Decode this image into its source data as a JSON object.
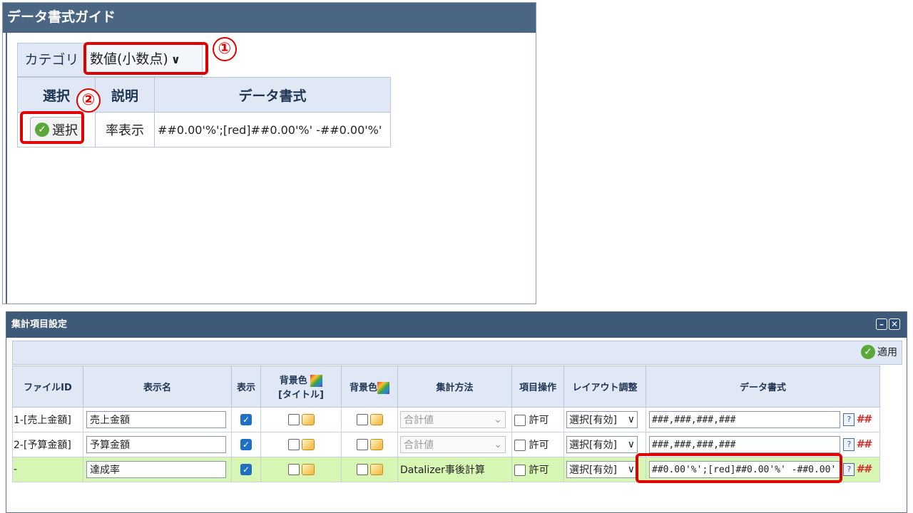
{
  "guide": {
    "title": "データ書式ガイド",
    "category_label": "カテゴリ",
    "category_value": "数値(小数点)",
    "headers": [
      "選択",
      "説明",
      "データ書式"
    ],
    "row": {
      "button": "選択",
      "desc": "率表示",
      "format": "##0.00'%';[red]##0.00'%' -##0.00'%'"
    },
    "badge1": "①",
    "badge2": "②"
  },
  "agg": {
    "title": "集計項目設定",
    "apply_label": "適用",
    "headers": {
      "file_id": "ファイルID",
      "name": "表示名",
      "show": "表示",
      "bg_title_1": "背景色",
      "bg_title_2": "[タイトル]",
      "bg": "背景色",
      "method": "集計方法",
      "item_op": "項目操作",
      "layout": "レイアウト調整",
      "format": "データ書式"
    },
    "rows": [
      {
        "file_id": "1-[売上金額]",
        "name": "売上金額",
        "method": "合計値",
        "permit": "許可",
        "layout": "選択[有効]",
        "format": "###,###,###,###"
      },
      {
        "file_id": "2-[予算金額]",
        "name": "予算金額",
        "method": "合計値",
        "permit": "許可",
        "layout": "選択[有効]",
        "format": "###,###,###,###"
      },
      {
        "file_id": "-",
        "name": "達成率",
        "method": "Datalizer事後計算",
        "permit": "許可",
        "layout": "選択[有効]",
        "format": "##0.00'%';[red]##0.00'%' -##0.00'"
      }
    ]
  },
  "colors": {
    "titlebar": "#4b6683",
    "header_bg": "#dfe8f4",
    "highlight_row": "#d7f5b3",
    "annotation_red": "#e00000"
  }
}
